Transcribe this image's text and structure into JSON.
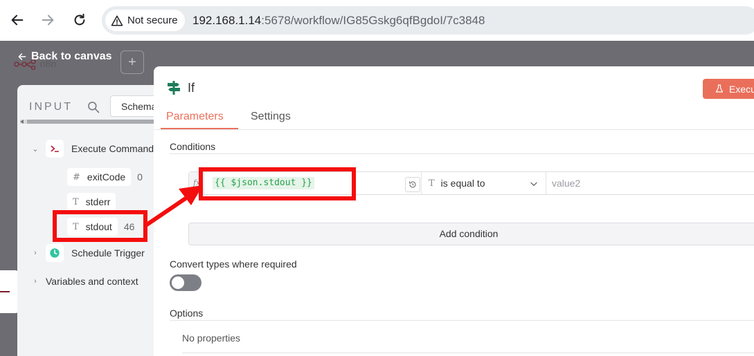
{
  "browser": {
    "not_secure_label": "Not secure",
    "url_host": "192.168.1.14",
    "url_rest": ":5678/workflow/IG85Gskg6qfBgdoI/7c3848"
  },
  "canvas": {
    "back_label": "Back to canvas",
    "logo_text": "n8n",
    "plus_label": "+"
  },
  "input_panel": {
    "title": "INPUT",
    "view_tab": "Schema",
    "nodes": [
      {
        "label": "Execute Command",
        "expanded": true,
        "fields": [
          {
            "type_icon": "#",
            "name": "exitCode",
            "value": "0"
          },
          {
            "type_icon": "T",
            "name": "stderr",
            "value": ""
          },
          {
            "type_icon": "T",
            "name": "stdout",
            "value": "46"
          }
        ]
      },
      {
        "label": "Schedule Trigger",
        "expanded": false
      }
    ],
    "variables_label": "Variables and context"
  },
  "node_panel": {
    "title": "If",
    "execute_label": "Execu",
    "tabs": [
      {
        "label": "Parameters",
        "active": true
      },
      {
        "label": "Settings",
        "active": false
      }
    ],
    "conditions_label": "Conditions",
    "condition": {
      "fx_label": "fx",
      "expression": "{{ $json.stdout }}",
      "type_icon": "T",
      "operator": "is equal to",
      "value_placeholder": "value2"
    },
    "add_condition_label": "Add condition",
    "convert_types_label": "Convert types where required",
    "convert_types_enabled": false,
    "options_label": "Options",
    "no_properties_label": "No properties"
  },
  "colors": {
    "accent": "#ea6f5a",
    "annotation": "#f40d0d",
    "expression_green": "#27a348",
    "overlay": "#6d6c72"
  }
}
